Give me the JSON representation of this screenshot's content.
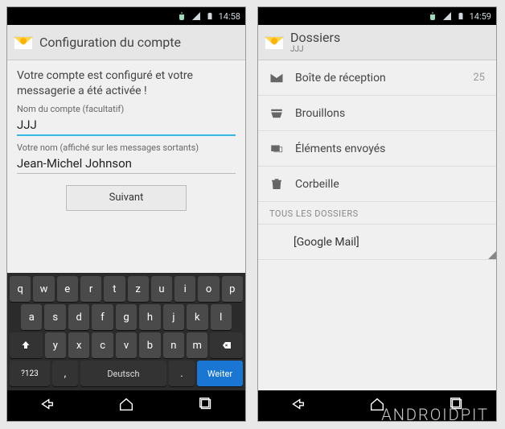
{
  "watermark": "ANDROIDPIT",
  "left": {
    "statusbar": {
      "time": "14:58"
    },
    "appbar": {
      "title": "Configuration du compte"
    },
    "content": {
      "success": "Votre compte est configuré et votre messagerie a été activée !",
      "account_label": "Nom du compte (facultatif)",
      "account_value": "JJJ",
      "name_label": "Votre nom (affiché sur les messages sortants)",
      "name_value": "Jean-Michel Johnson",
      "next": "Suivant"
    },
    "keyboard": {
      "row1": [
        "q",
        "w",
        "e",
        "r",
        "t",
        "z",
        "u",
        "i",
        "o",
        "p"
      ],
      "row2": [
        "a",
        "s",
        "d",
        "f",
        "g",
        "h",
        "j",
        "k",
        "l"
      ],
      "row3": [
        "y",
        "x",
        "c",
        "v",
        "b",
        "n",
        "m"
      ],
      "sym": "?123",
      "comma": ",",
      "space": "Deutsch",
      "period": ".",
      "enter": "Weiter"
    }
  },
  "right": {
    "statusbar": {
      "time": "14:59"
    },
    "appbar": {
      "title": "Dossiers",
      "subtitle": "JJJ"
    },
    "folders": {
      "inbox": {
        "label": "Boîte de réception",
        "count": "25"
      },
      "drafts": {
        "label": "Brouillons"
      },
      "sent": {
        "label": "Éléments envoyés"
      },
      "trash": {
        "label": "Corbeille"
      },
      "section": "TOUS LES DOSSIERS",
      "gmail": "[Google Mail]"
    }
  }
}
